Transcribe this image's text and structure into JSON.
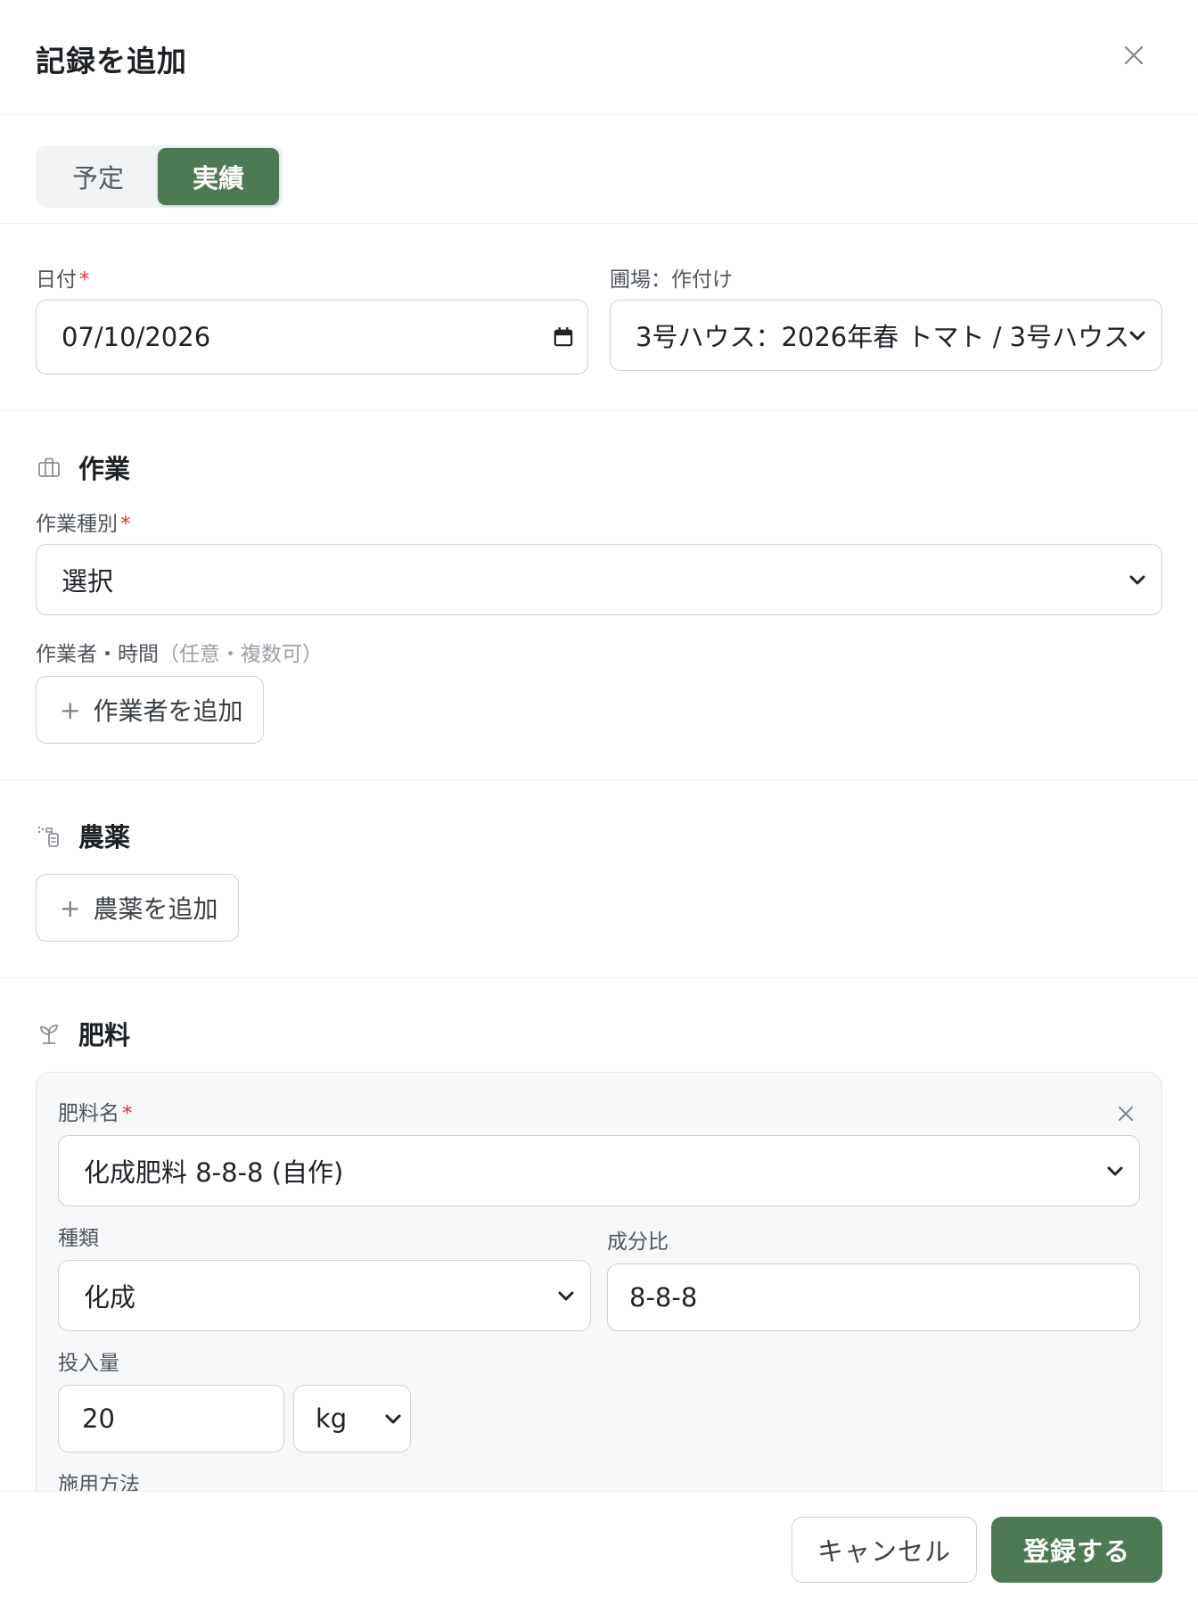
{
  "dialog": {
    "title": "記録を追加"
  },
  "mode_tabs": {
    "planned": "予定",
    "actual": "実績",
    "selected": "実績"
  },
  "date": {
    "label": "日付",
    "required_mark": "*",
    "value": "07/10/2026"
  },
  "field_crop": {
    "label": "圃場：作付け",
    "value": "3号ハウス：2026年春 トマト / 3号ハウス"
  },
  "work": {
    "title": "作業",
    "type_label": "作業種別",
    "type_value": "選択",
    "workers_label": "作業者・時間",
    "workers_hint": "（任意・複数可）",
    "add_worker": "作業者を追加"
  },
  "pesticide": {
    "title": "農薬",
    "add_pesticide": "農薬を追加"
  },
  "fertilizer": {
    "title": "肥料",
    "name_label": "肥料名",
    "name_value": "化成肥料 8-8-8 (自作)",
    "kind_label": "種類",
    "kind_value": "化成",
    "ratio_label": "成分比",
    "ratio_value": "8-8-8",
    "amount_label": "投入量",
    "amount_value": "20",
    "unit_value": "kg",
    "method_label": "施用方法"
  },
  "footer": {
    "cancel": "キャンセル",
    "submit": "登録する"
  },
  "colors": {
    "accent": "#4d7a55",
    "required": "#d63a3a",
    "border": "#cdd1d5",
    "card_bg": "#f7f8fa"
  }
}
